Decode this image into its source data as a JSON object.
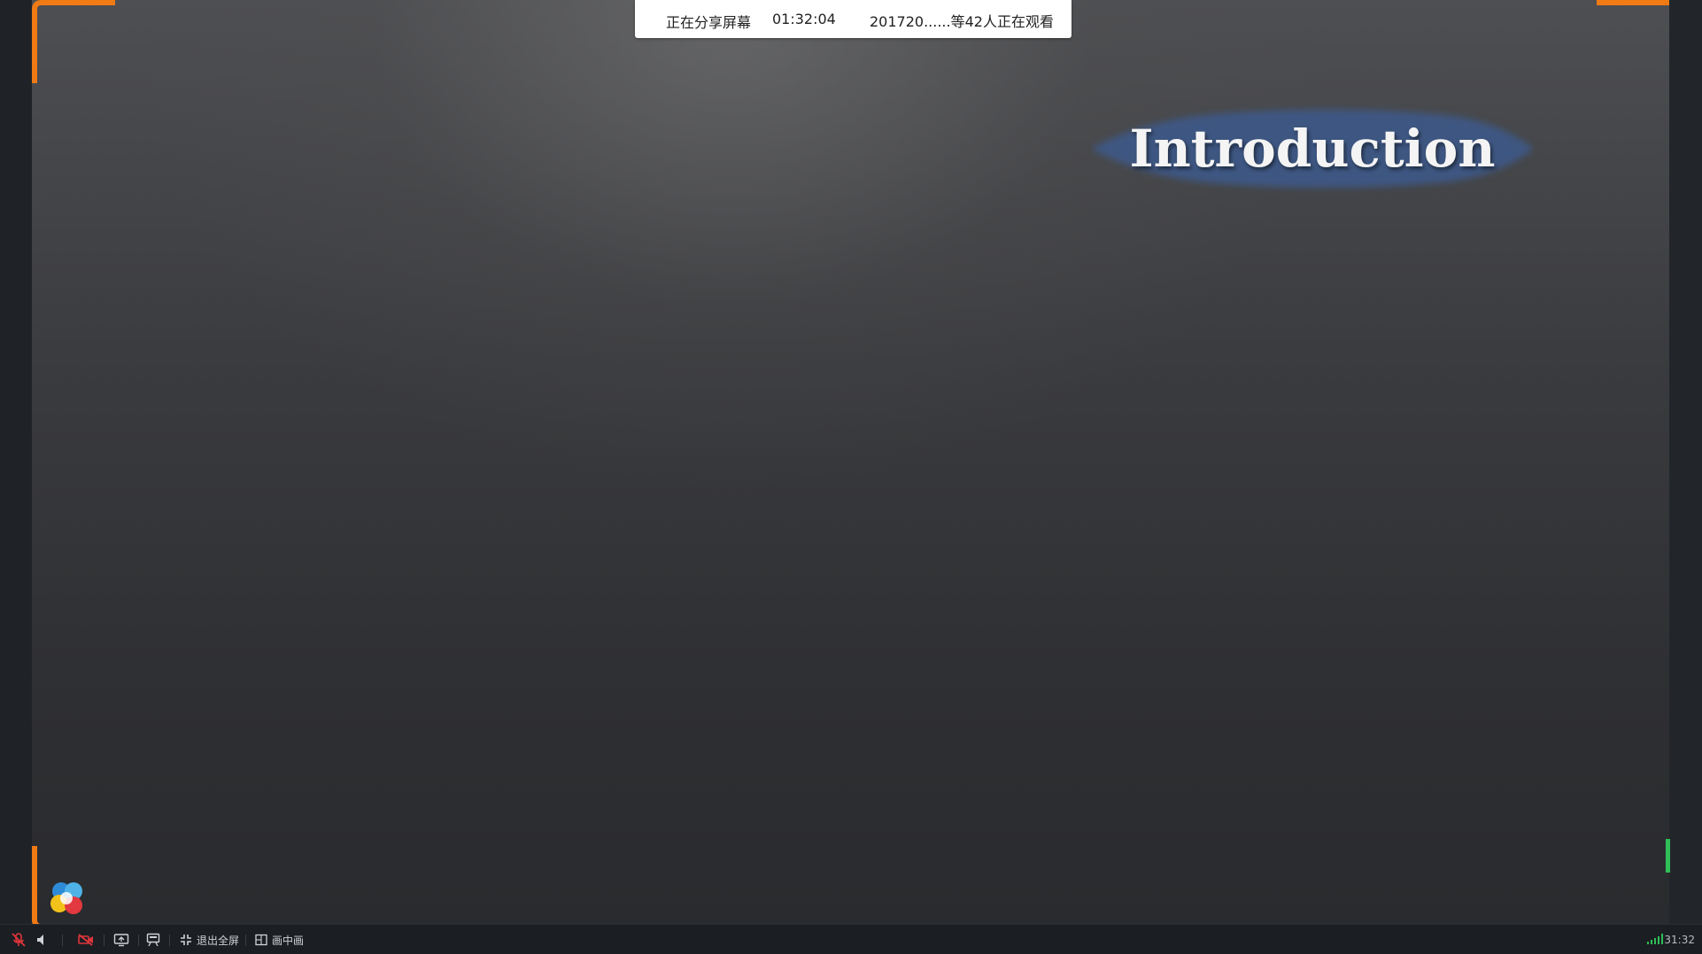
{
  "share_bar": {
    "status": "正在分享屏幕",
    "elapsed": "01:32:04",
    "viewers": "201720......等42人正在观看"
  },
  "slide": {
    "title": "Introduction"
  },
  "controls": {
    "exit_fullscreen_label": "退出全屏",
    "picture_in_picture_label": "画中画",
    "clock": "31:32"
  },
  "icons": {
    "mic": "mic-muted-icon",
    "speaker": "speaker-icon",
    "camera": "camera-off-icon",
    "share": "share-screen-icon",
    "whiteboard": "whiteboard-icon",
    "exit_fullscreen": "exit-fullscreen-icon",
    "pip": "picture-in-picture-icon",
    "signal": "signal-icon",
    "logo": "app-logo-icon"
  },
  "colors": {
    "accent_orange": "#f07a14",
    "banner_blue": "#3d5a8c",
    "mute_red": "#e0353b",
    "signal_green": "#2fbf57"
  }
}
